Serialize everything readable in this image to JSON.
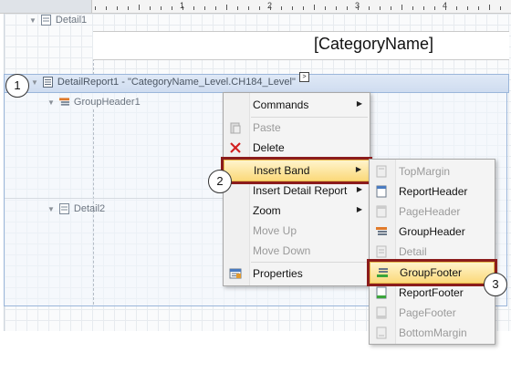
{
  "ruler": {
    "numbers": [
      "1",
      "2",
      "3",
      "4"
    ]
  },
  "bands": {
    "detail1": "Detail1",
    "detail_report": "DetailReport1 - \"CategoryName_Level.CH184_Level\"",
    "group_header": "GroupHeader1",
    "detail2": "Detail2"
  },
  "category_field": "[CategoryName]",
  "callouts": {
    "one": "1",
    "two": "2",
    "three": "3"
  },
  "context_menu": {
    "items": [
      {
        "label": "Commands",
        "submenu": true,
        "enabled": true
      },
      {
        "label": "Paste",
        "enabled": false
      },
      {
        "label": "Delete",
        "enabled": true
      },
      {
        "label": "Insert Band",
        "submenu": true,
        "enabled": true,
        "highlighted": true
      },
      {
        "label": "Insert Detail Report",
        "submenu": true,
        "enabled": true
      },
      {
        "label": "Zoom",
        "submenu": true,
        "enabled": true
      },
      {
        "label": "Move Up",
        "enabled": false
      },
      {
        "label": "Move Down",
        "enabled": false
      },
      {
        "label": "Properties",
        "enabled": true
      }
    ]
  },
  "submenu": {
    "items": [
      {
        "label": "TopMargin",
        "enabled": false
      },
      {
        "label": "ReportHeader",
        "enabled": true
      },
      {
        "label": "PageHeader",
        "enabled": false
      },
      {
        "label": "GroupHeader",
        "enabled": true
      },
      {
        "label": "Detail",
        "enabled": false
      },
      {
        "label": "GroupFooter",
        "enabled": true,
        "highlighted": true
      },
      {
        "label": "ReportFooter",
        "enabled": true
      },
      {
        "label": "PageFooter",
        "enabled": false
      },
      {
        "label": "BottomMargin",
        "enabled": false
      }
    ]
  },
  "colors": {
    "highlight_border": "#8b1c1c",
    "highlight_fill": "#fbd97a",
    "delete_icon": "#d22020"
  }
}
